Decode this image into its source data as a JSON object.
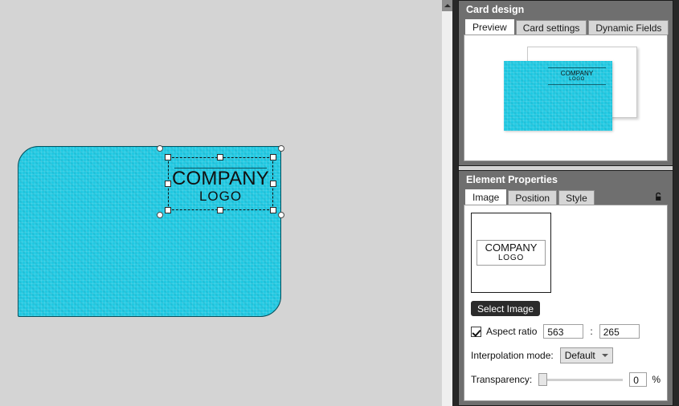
{
  "canvas": {
    "card": {
      "background_color": "#21c9e2",
      "border_color": "#0b6d7c"
    },
    "selected_element": {
      "logo_title": "COMPANY",
      "logo_subtitle": "LOGO",
      "handles": "8-square-resize-handles-and-4-circle-corner-handles"
    },
    "scrollbar": {
      "up_arrow_icon": "triangle-up-icon"
    }
  },
  "card_design_panel": {
    "title": "Card design",
    "tabs": [
      {
        "label": "Preview",
        "active": true
      },
      {
        "label": "Card settings",
        "active": false
      },
      {
        "label": "Dynamic Fields",
        "active": false
      }
    ],
    "preview": {
      "front_card_color": "#21c9e2",
      "back_card_color": "#ffffff",
      "logo_title": "COMPANY",
      "logo_subtitle": "LOGO"
    }
  },
  "element_properties_panel": {
    "title": "Element Properties",
    "lock_icon": "unlocked-padlock-icon",
    "tabs": [
      {
        "label": "Image",
        "active": true
      },
      {
        "label": "Position",
        "active": false
      },
      {
        "label": "Style",
        "active": false
      }
    ],
    "image_tab": {
      "thumbnail": {
        "logo_title": "COMPANY",
        "logo_subtitle": "LOGO"
      },
      "select_image_button": "Select Image",
      "aspect_ratio": {
        "label": "Aspect ratio",
        "checked": true,
        "width_value": "563",
        "separator": ":",
        "height_value": "265"
      },
      "interpolation": {
        "label": "Interpolation mode:",
        "selected": "Default"
      },
      "transparency": {
        "label": "Transparency:",
        "value": "0",
        "unit": "%",
        "slider_position_percent": 0
      }
    }
  }
}
